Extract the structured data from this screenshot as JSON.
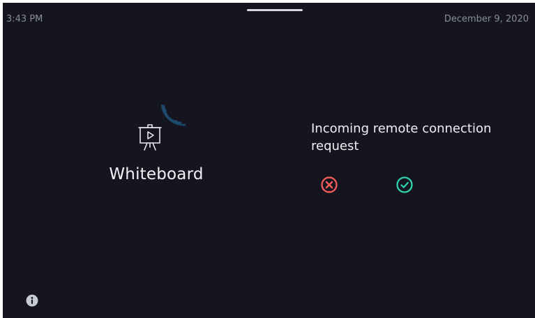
{
  "status_bar": {
    "time": "3:43 PM",
    "date": "December 9, 2020"
  },
  "device": {
    "name": "Whiteboard",
    "icon": "presentation-board-icon",
    "signal_icon": "wireless-signal-icon"
  },
  "request": {
    "message": "Incoming remote connection request",
    "decline_icon": "decline-icon",
    "accept_icon": "accept-icon"
  },
  "footer": {
    "info_icon": "info-icon"
  },
  "colors": {
    "background": "#14151f",
    "text_primary": "#f1f2f5",
    "text_muted": "#8a8d99",
    "decline": "#f05b5b",
    "accept": "#2fd5b0",
    "signal": "#1f4a70"
  }
}
